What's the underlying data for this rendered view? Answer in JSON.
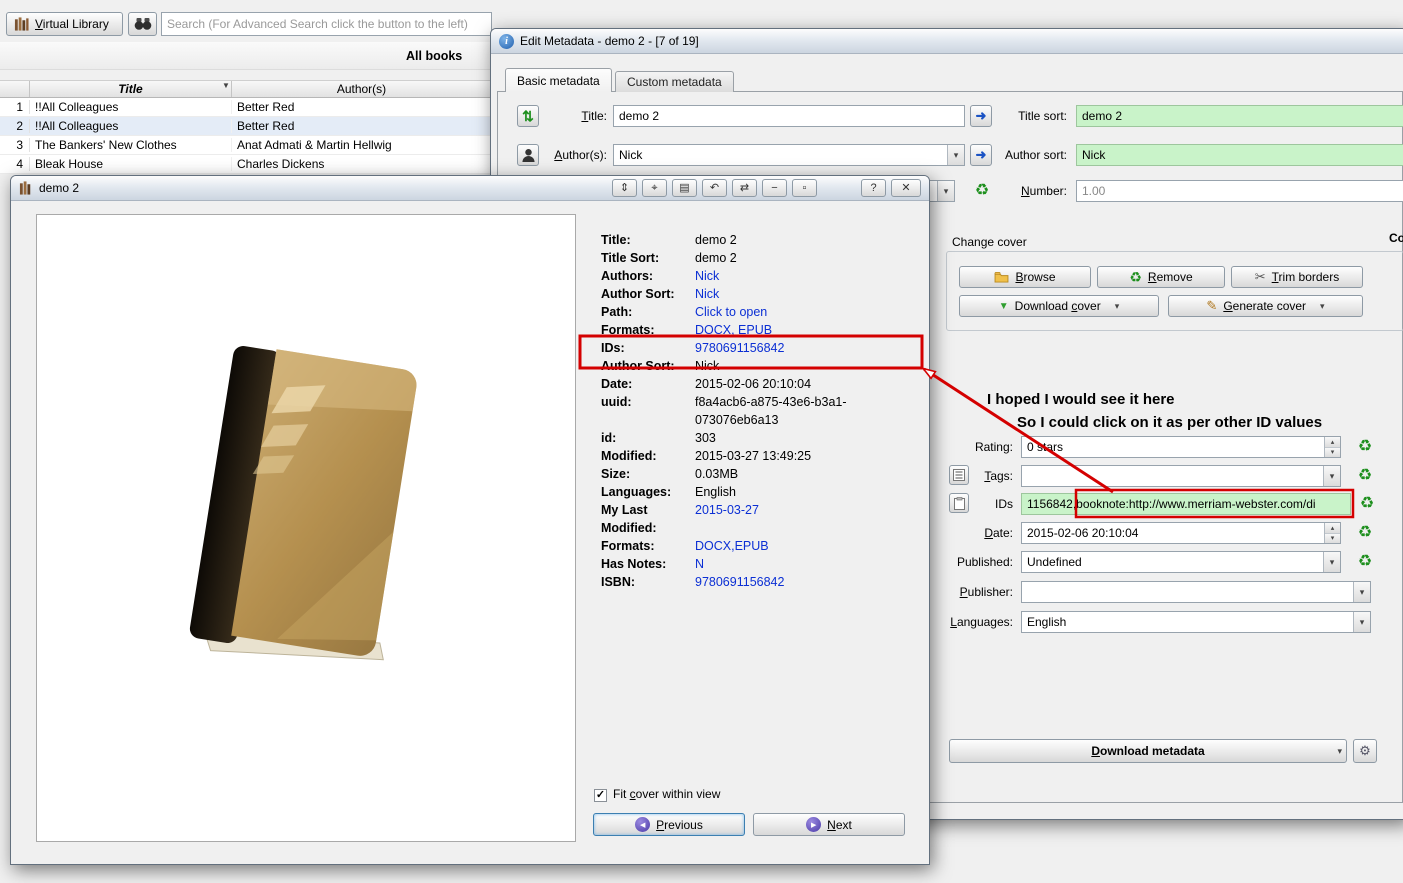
{
  "icons": {
    "refresh": "♻",
    "dropdown": "▾",
    "spin_up": "▴",
    "spin_down": "▾",
    "swap": "⇅",
    "arrow_right": "➜",
    "check": "✓",
    "help": "?",
    "close": "✕",
    "sort_indicator": "▼",
    "info": "i",
    "trim": "✂",
    "generate": "✎",
    "download_arrow": "▼",
    "gear": "⚙",
    "prev_arrow": "◀",
    "next_arrow": "▶"
  },
  "colors": {
    "annotation_red": "#d40000",
    "field_green": "#c9f3c9",
    "link_blue": "#0b2fd4",
    "titlebar_gradient_top": "#fdfdfd",
    "titlebar_gradient_bottom": "#ccd5e0"
  },
  "main_window": {
    "virtual_library_label": "Virtual Library",
    "search_placeholder": "Search (For Advanced Search click the button to the left)",
    "all_books_label": "All books",
    "table": {
      "columns": [
        "Title",
        "Author(s)"
      ],
      "rows": [
        {
          "num": "1",
          "title": "!!All Colleagues",
          "author": "Better Red"
        },
        {
          "num": "2",
          "title": "!!All Colleagues",
          "author": "Better Red"
        },
        {
          "num": "3",
          "title": "The Bankers' New Clothes",
          "author": "Anat Admati & Martin Hellwig"
        },
        {
          "num": "4",
          "title": "Bleak House",
          "author": "Charles Dickens"
        }
      ]
    }
  },
  "edit_dialog": {
    "title": "Edit Metadata - demo 2 -  [7 of 19]",
    "tabs": [
      {
        "label": "Basic metadata"
      },
      {
        "label": "Custom metadata"
      }
    ],
    "title_label": "Title:",
    "title_value": "demo 2",
    "title_sort_label": "Title sort:",
    "title_sort_value": "demo 2",
    "authors_label": "Author(s):",
    "authors_value": "Nick",
    "author_sort_label": "Author sort:",
    "author_sort_value": "Nick",
    "number_label": "Number:",
    "number_value": "1.00",
    "comments_label_cut": "Co",
    "change_cover": {
      "group_label": "Change cover",
      "browse_label": "Browse",
      "remove_label": "Remove",
      "trim_label": "Trim borders",
      "download_cover_label": "Download cover",
      "generate_cover_label": "Generate cover"
    },
    "rating_label": "Rating:",
    "rating_value": "0 stars",
    "tags_label": "Tags:",
    "tags_value": "",
    "ids_label": "IDs",
    "ids_prefix": "1156842,",
    "ids_highlight": "booknote:http://www.merriam-webster.com/di",
    "date_label": "Date:",
    "date_value": "2015-02-06 20:10:04",
    "published_label": "Published:",
    "published_value": "Undefined",
    "publisher_label": "Publisher:",
    "publisher_value": "",
    "languages_label": "Languages:",
    "languages_value": "English",
    "download_metadata_label": "Download metadata"
  },
  "annotation": {
    "line1": "I hoped I would see it here",
    "line2": "So I could click on it as per other ID values"
  },
  "book_window": {
    "title": "demo 2",
    "toolbar_buttons": [
      {
        "name": "fit-vertical-button",
        "glyph": "⇕"
      },
      {
        "name": "target-button",
        "glyph": "⌖"
      },
      {
        "name": "layout-button",
        "glyph": "▤"
      },
      {
        "name": "undo-button",
        "glyph": "↶"
      },
      {
        "name": "swap-horizontal-button",
        "glyph": "⇄"
      },
      {
        "name": "minimize-button",
        "glyph": "−"
      },
      {
        "name": "restore-button",
        "glyph": "▫"
      }
    ],
    "details": [
      {
        "label": "Title:",
        "value": "demo 2"
      },
      {
        "label": "Title Sort:",
        "value": "demo 2"
      },
      {
        "label": "Authors:",
        "value": "Nick"
      },
      {
        "label": "Author Sort:",
        "value": "Nick"
      },
      {
        "label": "Path:",
        "value": "Click to open"
      },
      {
        "label": "Formats:",
        "value": "DOCX, EPUB"
      },
      {
        "label": "IDs:",
        "value": "9780691156842"
      },
      {
        "label": "Author Sort:",
        "value": "Nick"
      },
      {
        "label": "Date:",
        "value": "2015-02-06 20:10:04"
      },
      {
        "label": "uuid:",
        "value": "f8a4acb6-a875-43e6-b3a1-073076eb6a13"
      },
      {
        "label": "id:",
        "value": "303"
      },
      {
        "label": "Modified:",
        "value": "2015-03-27 13:49:25"
      },
      {
        "label": "Size:",
        "value": "0.03MB"
      },
      {
        "label": "Languages:",
        "value": "English"
      },
      {
        "label": "My Last Modified:",
        "value": "2015-03-27"
      },
      {
        "label": "Formats:",
        "value": "DOCX,EPUB"
      },
      {
        "label": "Has Notes:",
        "value": "N"
      },
      {
        "label": "ISBN:",
        "value": "9780691156842"
      }
    ],
    "fit_cover_label": "Fit cover within view",
    "fit_cover_checked": true,
    "previous_label": "Previous",
    "next_label": "Next"
  }
}
